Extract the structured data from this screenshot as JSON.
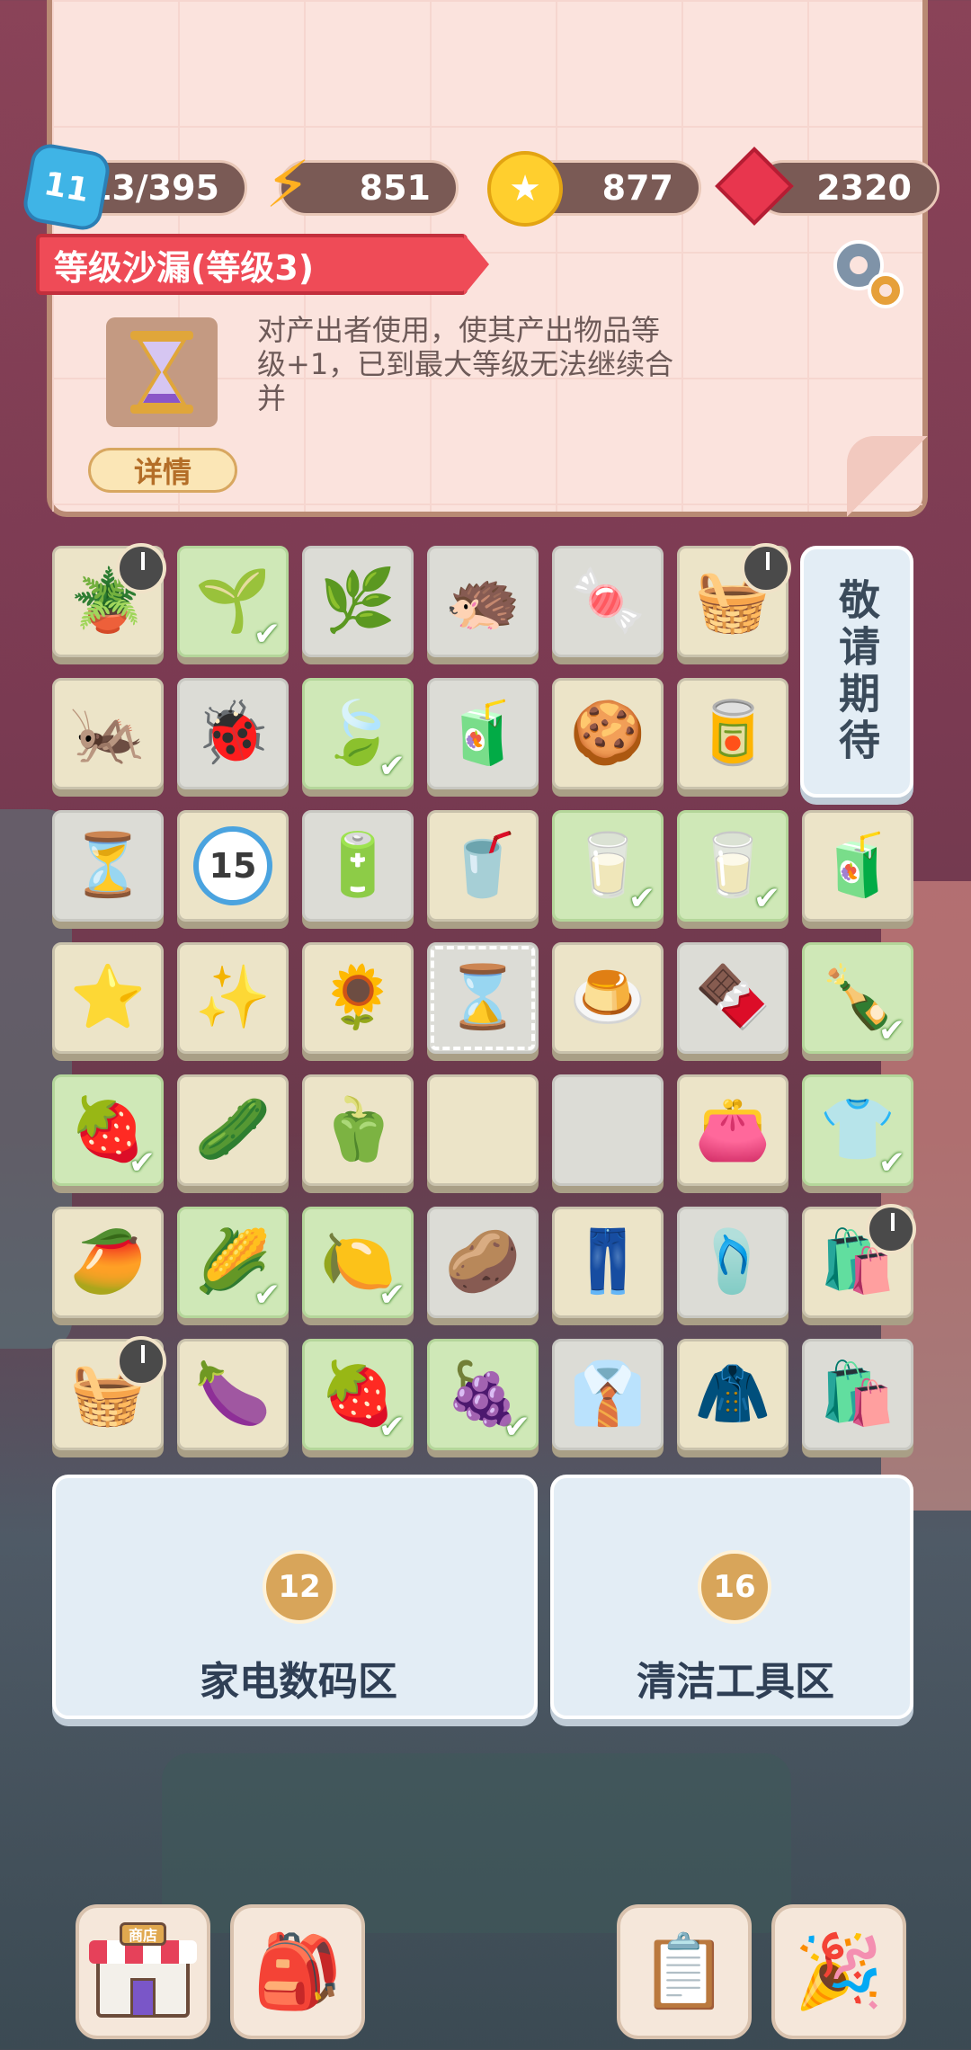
{
  "stats": {
    "level": "11",
    "experience": "313/395",
    "energy": "851",
    "coins": "877",
    "gems": "2320"
  },
  "selected_item": {
    "title": "等级沙漏(等级3)",
    "description": "对产出者使用，使其产出物品等级+1，已到最大等级无法继续合并",
    "detail_button": "详情"
  },
  "locked_column_label": "敬请期待",
  "board": [
    [
      {
        "icon": "🪴",
        "bg": "beige",
        "timer": true
      },
      {
        "icon": "🌱",
        "bg": "green",
        "check": true
      },
      {
        "icon": "🌿",
        "bg": "gray"
      },
      {
        "icon": "🦔",
        "bg": "gray"
      },
      {
        "icon": "🍬",
        "bg": "gray"
      },
      {
        "icon": "🧺",
        "bg": "beige",
        "timer": true
      }
    ],
    [
      {
        "icon": "🦗",
        "bg": "beige"
      },
      {
        "icon": "🐞",
        "bg": "gray"
      },
      {
        "icon": "🍃",
        "bg": "green",
        "check": true
      },
      {
        "icon": "🧃",
        "bg": "gray"
      },
      {
        "icon": "🍪",
        "bg": "beige"
      },
      {
        "icon": "🥫",
        "bg": "beige"
      },
      null
    ],
    [
      {
        "icon": "⏳",
        "bg": "gray"
      },
      {
        "icon": "15",
        "bg": "beige"
      },
      {
        "icon": "🔋",
        "bg": "gray"
      },
      {
        "icon": "🥤",
        "bg": "beige"
      },
      {
        "icon": "🥛",
        "bg": "green",
        "check": true
      },
      {
        "icon": "🥛",
        "bg": "green",
        "check": true
      },
      {
        "icon": "🧃",
        "bg": "beige"
      }
    ],
    [
      {
        "icon": "⭐",
        "bg": "beige"
      },
      {
        "icon": "✨",
        "bg": "beige"
      },
      {
        "icon": "🌻",
        "bg": "beige"
      },
      {
        "icon": "⌛",
        "bg": "gray",
        "selected": true
      },
      {
        "icon": "🍮",
        "bg": "beige"
      },
      {
        "icon": "🍫",
        "bg": "gray"
      },
      {
        "icon": "🍾",
        "bg": "green",
        "check": true
      }
    ],
    [
      {
        "icon": "🍓",
        "bg": "green",
        "check": true
      },
      {
        "icon": "🥒",
        "bg": "beige"
      },
      {
        "icon": "🫑",
        "bg": "beige"
      },
      {
        "icon": "",
        "bg": "beige"
      },
      {
        "icon": "",
        "bg": "gray"
      },
      {
        "icon": "👛",
        "bg": "beige"
      },
      {
        "icon": "👕",
        "bg": "green",
        "check": true
      }
    ],
    [
      {
        "icon": "🥭",
        "bg": "beige"
      },
      {
        "icon": "🌽",
        "bg": "green",
        "check": true
      },
      {
        "icon": "🍋",
        "bg": "green",
        "check": true
      },
      {
        "icon": "🥔",
        "bg": "gray"
      },
      {
        "icon": "👖",
        "bg": "beige"
      },
      {
        "icon": "🩴",
        "bg": "gray"
      },
      {
        "icon": "🛍️",
        "bg": "beige",
        "timer": true
      }
    ],
    [
      {
        "icon": "🧺",
        "bg": "beige",
        "timer": true
      },
      {
        "icon": "🍆",
        "bg": "beige"
      },
      {
        "icon": "🍓",
        "bg": "green",
        "check": true
      },
      {
        "icon": "🍇",
        "bg": "green",
        "check": true
      },
      {
        "icon": "👔",
        "bg": "gray"
      },
      {
        "icon": "🧥",
        "bg": "beige"
      },
      {
        "icon": "🛍️",
        "bg": "gray"
      }
    ]
  ],
  "zones": [
    {
      "name": "家电数码区",
      "unlock_level": "12"
    },
    {
      "name": "清洁工具区",
      "unlock_level": "16"
    }
  ],
  "bottom_bar": {
    "shop_sign": "商店",
    "items": [
      "shop",
      "backpack",
      "tasks",
      "party"
    ]
  }
}
